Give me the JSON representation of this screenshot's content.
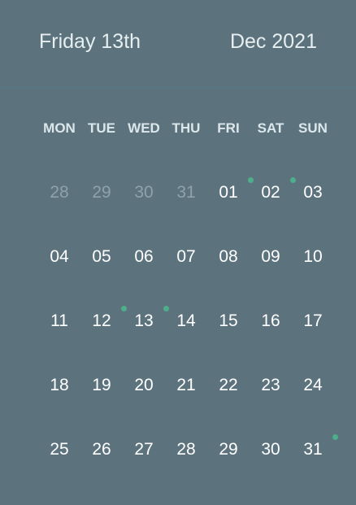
{
  "header": {
    "selected_day": "Friday 13th",
    "month_year": "Dec 2021"
  },
  "weekdays": [
    "MON",
    "TUE",
    "WED",
    "THU",
    "FRI",
    "SAT",
    "SUN"
  ],
  "colors": {
    "background": "#5c737e",
    "event_dot": "#4caf8a"
  },
  "days": [
    {
      "label": "28",
      "muted": true
    },
    {
      "label": "29",
      "muted": true
    },
    {
      "label": "30",
      "muted": true
    },
    {
      "label": "31",
      "muted": true
    },
    {
      "label": "01",
      "event": true
    },
    {
      "label": "02",
      "event": true
    },
    {
      "label": "03"
    },
    {
      "label": "04"
    },
    {
      "label": "05"
    },
    {
      "label": "06"
    },
    {
      "label": "07"
    },
    {
      "label": "08"
    },
    {
      "label": "09"
    },
    {
      "label": "10"
    },
    {
      "label": "11"
    },
    {
      "label": "12",
      "event": true
    },
    {
      "label": "13",
      "event": true
    },
    {
      "label": "14"
    },
    {
      "label": "15"
    },
    {
      "label": "16"
    },
    {
      "label": "17"
    },
    {
      "label": "18"
    },
    {
      "label": "19"
    },
    {
      "label": "20"
    },
    {
      "label": "21"
    },
    {
      "label": "22"
    },
    {
      "label": "23"
    },
    {
      "label": "24"
    },
    {
      "label": "25"
    },
    {
      "label": "26"
    },
    {
      "label": "27"
    },
    {
      "label": "28"
    },
    {
      "label": "29"
    },
    {
      "label": "30"
    },
    {
      "label": "31",
      "event": true
    }
  ]
}
